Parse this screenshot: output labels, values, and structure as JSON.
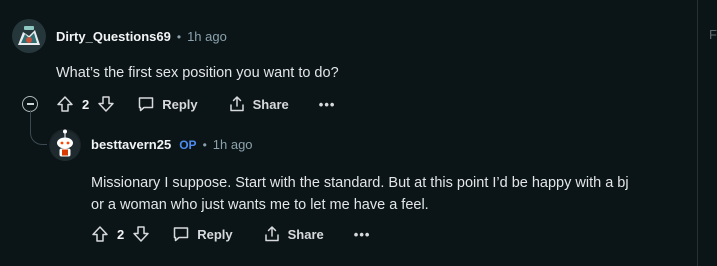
{
  "colors": {
    "background": "#0b1416",
    "op_badge": "#4b8cf0",
    "meta": "#8ba2ad",
    "text": "#e3e6e8"
  },
  "edge_glyph": "F",
  "comments": [
    {
      "author": "Dirty_Questions69",
      "separator": "•",
      "time": "1h ago",
      "body": "What’s the first sex position you want to do?",
      "votes": "2",
      "reply_label": "Reply",
      "share_label": "Share",
      "more_label": "•••"
    },
    {
      "author": "besttavern25",
      "op_badge": "OP",
      "separator": "•",
      "time": "1h ago",
      "body_line1": "Missionary I suppose. Start with the standard. But at this point I’d be happy with a bj",
      "body_line2": "or a woman who just wants me to let me have a feel.",
      "votes": "2",
      "reply_label": "Reply",
      "share_label": "Share",
      "more_label": "•••"
    }
  ],
  "icons": [
    "upvote-icon",
    "downvote-icon",
    "reply-bubble-icon",
    "share-icon",
    "collapse-icon",
    "more-icon"
  ]
}
